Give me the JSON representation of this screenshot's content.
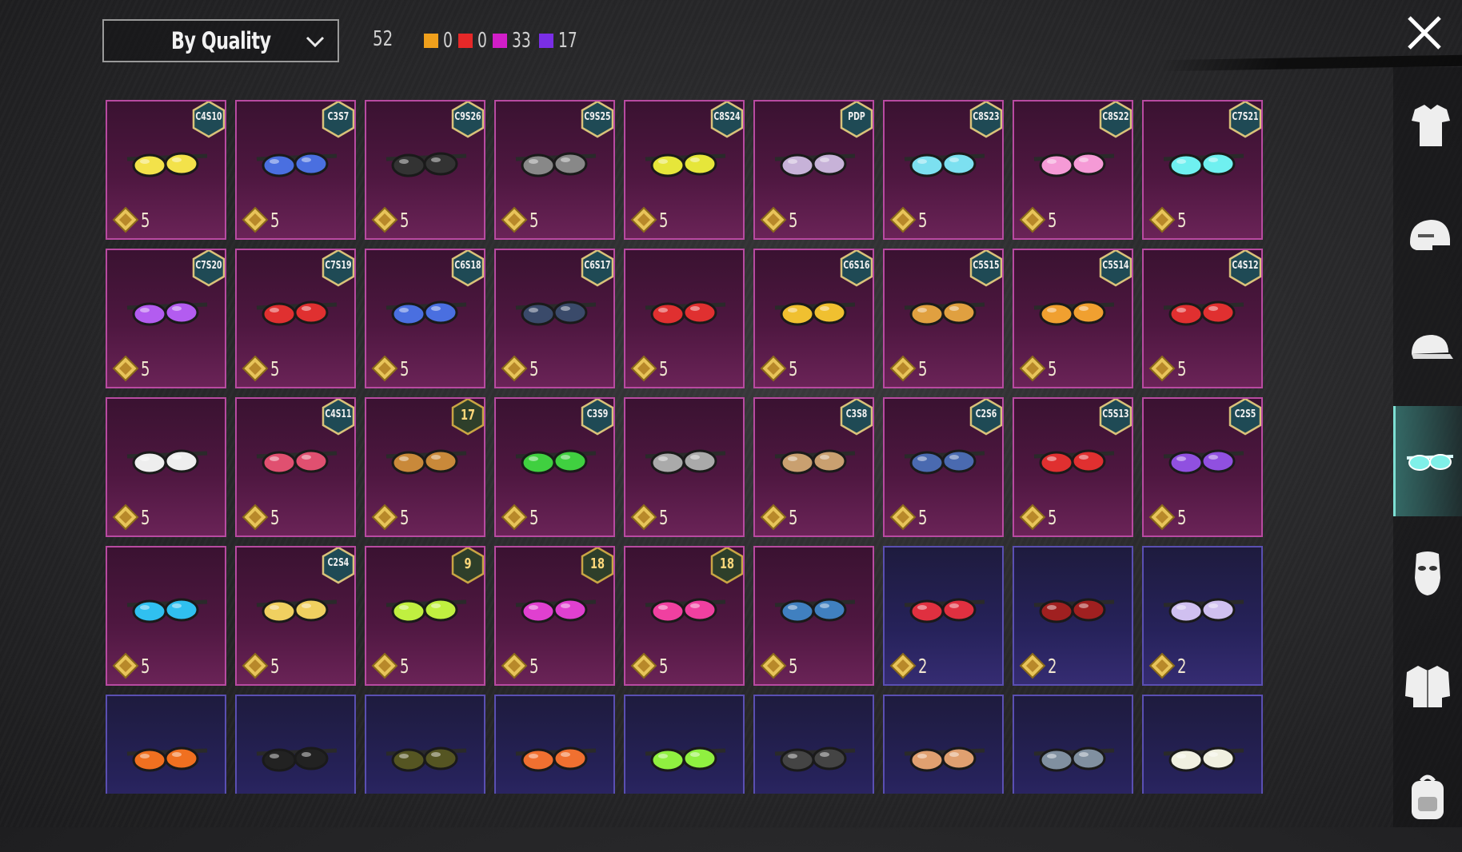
{
  "sort": {
    "label": "By Quality",
    "icon": "chevron-down-icon"
  },
  "summary": {
    "total": "52",
    "counts": [
      {
        "color": "#f0a01c",
        "value": "0"
      },
      {
        "color": "#e62828",
        "value": "0"
      },
      {
        "color": "#d21ec8",
        "value": "33"
      },
      {
        "color": "#7a2ee6",
        "value": "17"
      }
    ]
  },
  "close_icon": "close-icon",
  "currency_icon": "bp-diamond-icon",
  "items": [
    {
      "badge": "C4S10",
      "price": "5",
      "rarity": "purple",
      "icon": "round-sunglasses-icon"
    },
    {
      "badge": "C3S7",
      "price": "5",
      "rarity": "purple",
      "icon": "masquerade-mask-icon"
    },
    {
      "badge": "C9S26",
      "price": "5",
      "rarity": "purple",
      "icon": "thin-sunglasses-icon"
    },
    {
      "badge": "C9S25",
      "price": "5",
      "rarity": "purple",
      "icon": "sport-sunglasses-icon"
    },
    {
      "badge": "C8S24",
      "price": "5",
      "rarity": "purple",
      "icon": "yellow-shield-glasses-icon"
    },
    {
      "badge": "PDP",
      "price": "5",
      "rarity": "purple",
      "icon": "cat-eye-glasses-icon"
    },
    {
      "badge": "C8S23",
      "price": "5",
      "rarity": "purple",
      "icon": "goggles-icon"
    },
    {
      "badge": "C8S22",
      "price": "5",
      "rarity": "purple",
      "icon": "pink-shield-glasses-icon"
    },
    {
      "badge": "C7S21",
      "price": "5",
      "rarity": "purple",
      "icon": "cyan-shield-glasses-icon"
    },
    {
      "badge": "C7S20",
      "price": "5",
      "rarity": "purple",
      "icon": "purple-visor-glasses-icon"
    },
    {
      "badge": "C7S19",
      "price": "5",
      "rarity": "purple",
      "icon": "tech-goggles-icon"
    },
    {
      "badge": "C6S18",
      "price": "5",
      "rarity": "purple",
      "icon": "tactical-visor-icon"
    },
    {
      "badge": "C6S17",
      "price": "5",
      "rarity": "purple",
      "icon": "dark-visor-icon"
    },
    {
      "badge": "",
      "price": "5",
      "rarity": "purple",
      "icon": "red-sport-glasses-icon"
    },
    {
      "badge": "C6S16",
      "price": "5",
      "rarity": "purple",
      "icon": "gold-visor-icon"
    },
    {
      "badge": "C5S15",
      "price": "5",
      "rarity": "purple",
      "icon": "round-glasses-icon"
    },
    {
      "badge": "C5S14",
      "price": "5",
      "rarity": "purple",
      "icon": "rainbow-shield-glasses-icon"
    },
    {
      "badge": "C4S12",
      "price": "5",
      "rarity": "purple",
      "icon": "heart-glasses-icon"
    },
    {
      "badge": "",
      "price": "5",
      "rarity": "purple",
      "icon": "ski-goggles-icon"
    },
    {
      "badge": "C4S11",
      "price": "5",
      "rarity": "purple",
      "icon": "red-mirror-glasses-icon"
    },
    {
      "badge": "17",
      "badge_type": "level",
      "price": "5",
      "rarity": "purple",
      "icon": "aviator-glasses-icon"
    },
    {
      "badge": "C3S9",
      "price": "5",
      "rarity": "purple",
      "icon": "green-goggles-icon"
    },
    {
      "badge": "",
      "price": "5",
      "rarity": "purple",
      "icon": "metal-visor-icon"
    },
    {
      "badge": "C3S8",
      "price": "5",
      "rarity": "purple",
      "icon": "tan-shield-glasses-icon"
    },
    {
      "badge": "C2S6",
      "price": "5",
      "rarity": "purple",
      "icon": "blue-goggles-icon"
    },
    {
      "badge": "C5S13",
      "price": "5",
      "rarity": "purple",
      "icon": "red-round-glasses-icon"
    },
    {
      "badge": "C2S5",
      "price": "5",
      "rarity": "purple",
      "icon": "purple-round-glasses-icon"
    },
    {
      "badge": "",
      "price": "5",
      "rarity": "purple",
      "icon": "cyan-goggles-icon"
    },
    {
      "badge": "C2S4",
      "price": "5",
      "rarity": "purple",
      "icon": "gold-tech-glasses-icon"
    },
    {
      "badge": "9",
      "badge_type": "level",
      "price": "5",
      "rarity": "purple",
      "icon": "visor-stripe-icon"
    },
    {
      "badge": "18",
      "badge_type": "level",
      "price": "5",
      "rarity": "purple",
      "icon": "neon-visor-icon"
    },
    {
      "badge": "18",
      "badge_type": "level",
      "price": "5",
      "rarity": "purple",
      "icon": "pink-neon-visor-icon"
    },
    {
      "badge": "",
      "price": "5",
      "rarity": "purple",
      "icon": "cyclops-visor-icon"
    },
    {
      "badge": "",
      "price": "2",
      "rarity": "blue",
      "icon": "small-red-glasses-icon"
    },
    {
      "badge": "",
      "price": "2",
      "rarity": "blue",
      "icon": "red-bandana-icon"
    },
    {
      "badge": "",
      "price": "2",
      "rarity": "blue",
      "icon": "heart-frame-glasses-icon"
    },
    {
      "badge": "",
      "price": "",
      "rarity": "blue",
      "icon": "orange-goggles-icon"
    },
    {
      "badge": "",
      "price": "",
      "rarity": "blue",
      "icon": "black-mask-icon"
    },
    {
      "badge": "",
      "price": "",
      "rarity": "blue",
      "icon": "brown-sunglasses-icon"
    },
    {
      "badge": "",
      "price": "",
      "rarity": "blue",
      "icon": "orange-shades-icon"
    },
    {
      "badge": "",
      "price": "",
      "rarity": "blue",
      "icon": "lime-glasses-icon"
    },
    {
      "badge": "",
      "price": "",
      "rarity": "blue",
      "icon": "black-visor-icon"
    },
    {
      "badge": "",
      "price": "",
      "rarity": "blue",
      "icon": "leopard-glasses-icon"
    },
    {
      "badge": "",
      "price": "",
      "rarity": "blue",
      "icon": "gold-aviator-icon"
    },
    {
      "badge": "",
      "price": "",
      "rarity": "blue",
      "icon": "eagle-mask-icon"
    }
  ],
  "sidebar": [
    {
      "icon": "outfit-icon",
      "active": false
    },
    {
      "icon": "helmet-icon",
      "active": false
    },
    {
      "icon": "cap-icon",
      "active": false
    },
    {
      "icon": "glasses-icon",
      "active": true
    },
    {
      "icon": "mask-icon",
      "active": false
    },
    {
      "icon": "jacket-icon",
      "active": false
    },
    {
      "icon": "backpack-icon",
      "active": false
    }
  ]
}
